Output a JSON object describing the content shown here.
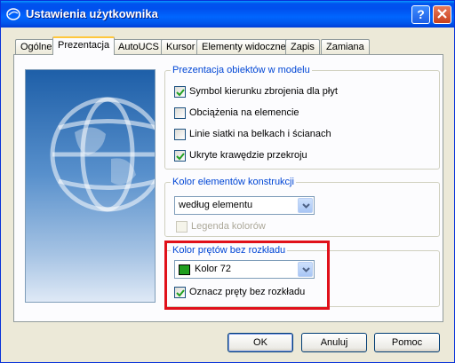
{
  "window": {
    "title": "Ustawienia użytkownika",
    "help_button": "?",
    "colors": {
      "titlebar": "#0055ea",
      "background": "#ece9d8",
      "accent": "#0046d5",
      "highlight": "#e0101a"
    }
  },
  "tabs": [
    {
      "label": "Ogólne",
      "active": false
    },
    {
      "label": "Prezentacja",
      "active": true
    },
    {
      "label": "AutoUCS",
      "active": false
    },
    {
      "label": "Kursor",
      "active": false
    },
    {
      "label": "Elementy widoczne",
      "active": false
    },
    {
      "label": "Zapis",
      "active": false
    },
    {
      "label": "Zamiana",
      "active": false
    }
  ],
  "preview": {
    "icon": "globe-icon"
  },
  "groups": {
    "model": {
      "legend": "Prezentacja obiektów w modelu",
      "options": [
        {
          "label": "Symbol kierunku zbrojenia dla płyt",
          "checked": true
        },
        {
          "label": "Obciążenia na elemencie",
          "checked": false
        },
        {
          "label": "Linie siatki na belkach i ścianach",
          "checked": false
        },
        {
          "label": "Ukryte krawędzie przekroju",
          "checked": true
        }
      ]
    },
    "construction_color": {
      "legend": "Kolor elementów konstrukcji",
      "select_value": "według elementu",
      "legend_option": {
        "label": "Legenda kolorów",
        "checked": false,
        "disabled": true
      }
    },
    "bar_color": {
      "legend": "Kolor prętów bez rozkładu",
      "select_value": "Kolor 72",
      "swatch_color": "#1f9e1f",
      "mark_option": {
        "label": "Oznacz pręty bez rozkładu",
        "checked": true
      }
    }
  },
  "buttons": {
    "ok": "OK",
    "cancel": "Anuluj",
    "help": "Pomoc"
  }
}
